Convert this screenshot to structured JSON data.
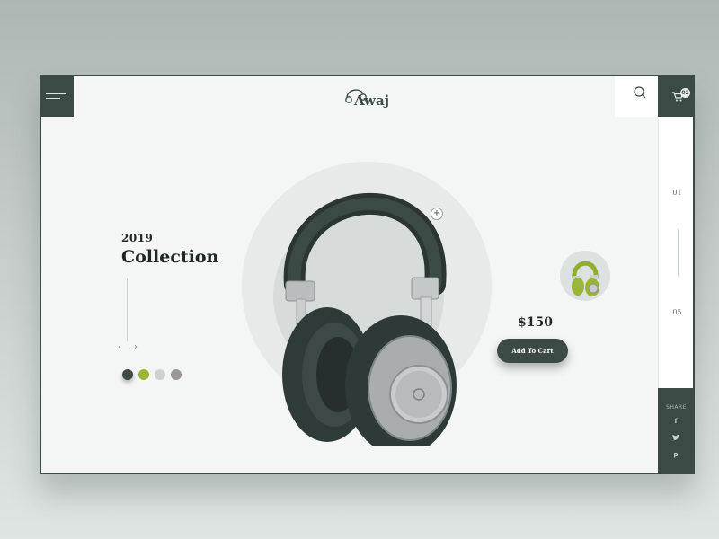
{
  "header": {
    "brand": "Awaj",
    "cart_count": "02"
  },
  "hero": {
    "year": "2019",
    "title": "Collection",
    "price": "$150",
    "add_to_cart_label": "Add To Cart"
  },
  "pagination": {
    "current": "01",
    "total": "05"
  },
  "colors": {
    "accent": "#3c4a45",
    "swatches": [
      "#3e4a46",
      "#9ab630",
      "#cdd2d0",
      "#9a9799"
    ]
  },
  "share": {
    "label": "SHARE",
    "networks": [
      "facebook-icon",
      "twitter-icon",
      "pinterest-icon"
    ]
  },
  "icons": {
    "facebook": "f",
    "twitter": "✦",
    "pinterest": "p"
  }
}
